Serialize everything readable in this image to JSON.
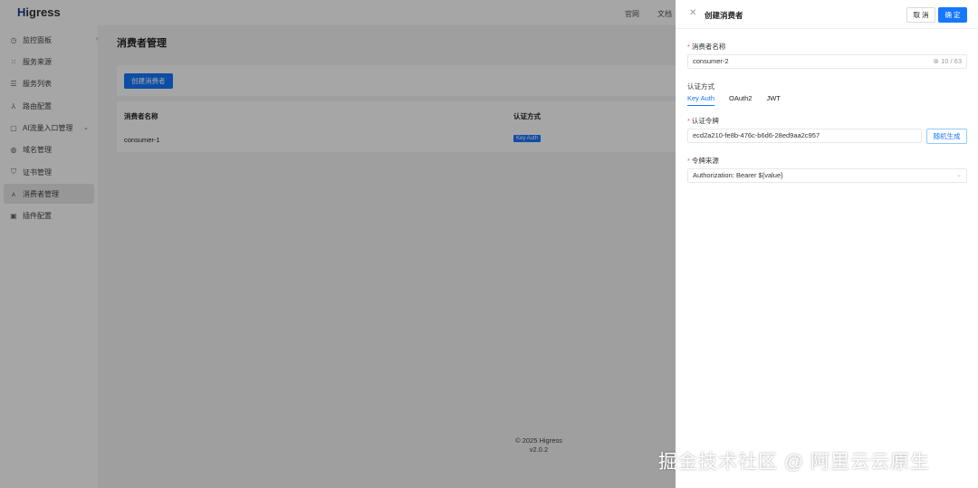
{
  "header": {
    "logo": "Higress",
    "links": [
      "官网",
      "文档"
    ]
  },
  "sidebar": {
    "items": [
      {
        "label": "监控面板",
        "icon": "dashboard-icon"
      },
      {
        "label": "服务来源",
        "icon": "source-icon"
      },
      {
        "label": "服务列表",
        "icon": "list-icon"
      },
      {
        "label": "路由配置",
        "icon": "route-icon"
      },
      {
        "label": "AI流量入口管理",
        "icon": "ai-icon"
      },
      {
        "label": "域名管理",
        "icon": "globe-icon"
      },
      {
        "label": "证书管理",
        "icon": "shield-icon"
      },
      {
        "label": "消费者管理",
        "icon": "user-icon"
      },
      {
        "label": "插件配置",
        "icon": "plugin-icon"
      }
    ]
  },
  "page": {
    "title": "消费者管理",
    "create_button": "创建消费者",
    "columns": [
      "消费者名称",
      "认证方式"
    ],
    "rows": [
      {
        "name": "consumer-1",
        "auth": "Key Auth"
      }
    ]
  },
  "footer": {
    "copyright": "© 2025 Higress",
    "version": "v2.0.2"
  },
  "drawer": {
    "title": "创建消费者",
    "cancel": "取 消",
    "ok": "确 定",
    "name_label": "消费者名称",
    "name_value": "consumer-2",
    "name_count": "10 / 63",
    "auth_label": "认证方式",
    "tabs": [
      "Key Auth",
      "OAuth2",
      "JWT"
    ],
    "token_label": "认证令牌",
    "token_value": "ecd2a210-fe8b-476c-b6d6-28ed9aa2c957",
    "generate": "随机生成",
    "source_label": "令牌来源",
    "source_value": "Authorization: Bearer ${value}"
  },
  "watermark": "掘金技术社区 @ 阿里云云原生"
}
